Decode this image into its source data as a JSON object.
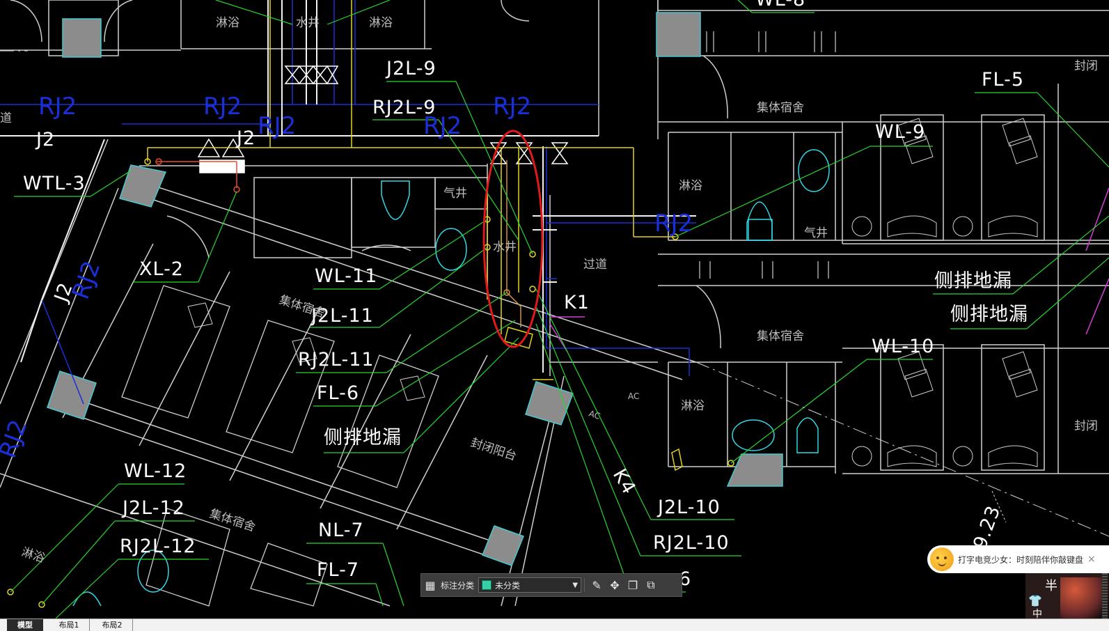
{
  "drawing": {
    "pipe_labels": [
      "J2L-9",
      "RJ2L-9",
      "FL-5",
      "WL-9",
      "WTL-3",
      "XL-2",
      "WL-11",
      "J2L-11",
      "RJ2L-11",
      "FL-6",
      "WL-10",
      "WL-12",
      "J2L-12",
      "RJ2L-12",
      "NL-7",
      "FL-7",
      "J2L-10",
      "RJ2L-10",
      "K1",
      "K4",
      "J2",
      "J2",
      "J2"
    ],
    "blue_labels": [
      "RJ2",
      "RJ2",
      "RJ2",
      "RJ2",
      "RJ2",
      "RJ2",
      "RJ2",
      "RJ2"
    ],
    "drain_labels": [
      "侧排地漏",
      "侧排地漏",
      "侧排地漏"
    ],
    "room_labels": [
      "淋浴",
      "水井",
      "淋浴",
      "集体宿舍",
      "淋浴",
      "气井",
      "过道",
      "集体宿舍",
      "集体宿舍",
      "淋浴",
      "封闭阳台",
      "集体宿舍",
      "淋浴",
      "水井",
      "气井",
      "封闭",
      "封闭",
      "道",
      "AC",
      "AC"
    ],
    "partial_labels": [
      "WL-8",
      "6"
    ],
    "dimension_label": "9.23"
  },
  "toolbar": {
    "icons": [
      "grid-icon",
      "edit-icon",
      "move-icon",
      "copy-icon",
      "paste-icon"
    ],
    "category_label": "标注分类",
    "category_value": "未分类",
    "category_color": "#35d1a7"
  },
  "tabs": [
    "模型",
    "布局1",
    "布局2"
  ],
  "ime_ad": {
    "text": "打字电竞少女：时刻陪伴你敲键盘",
    "close": "×"
  },
  "ime_widget": {
    "char_top": "半",
    "char_bottom": "中"
  }
}
